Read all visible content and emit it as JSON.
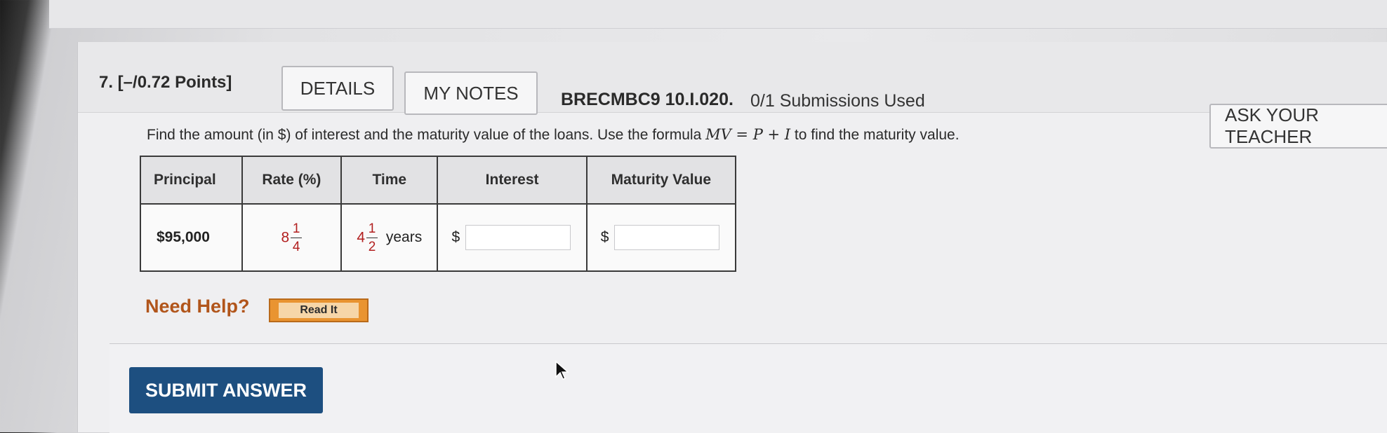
{
  "question": {
    "label": "7. [–/0.72 Points]",
    "details_label": "DETAILS",
    "my_notes_label": "MY NOTES",
    "problem_code": "BRECMBC9 10.I.020.",
    "submissions": "0/1 Submissions Used",
    "ask_teacher_label": "ASK YOUR TEACHER",
    "prompt_before": "Find the amount (in $) of interest and the maturity value of the loans. Use the formula ",
    "formula": "MV = P + I",
    "prompt_after": " to find the maturity value."
  },
  "table": {
    "headers": [
      "Principal",
      "Rate (%)",
      "Time",
      "Interest",
      "Maturity Value"
    ],
    "row": {
      "principal": "$95,000",
      "rate": {
        "whole": "8",
        "numerator": "1",
        "denominator": "4"
      },
      "time": {
        "whole": "4",
        "numerator": "1",
        "denominator": "2",
        "unit": "years"
      },
      "interest_currency": "$",
      "interest_value": "",
      "maturity_currency": "$",
      "maturity_value": ""
    }
  },
  "help": {
    "label": "Need Help?",
    "read_it_label": "Read It"
  },
  "submit_label": "SUBMIT ANSWER",
  "colors": {
    "submit_bg": "#1d4f80",
    "need_help": "#b1551b",
    "read_it_bg": "#e99431",
    "rate_fraction": "#b21f1f"
  }
}
